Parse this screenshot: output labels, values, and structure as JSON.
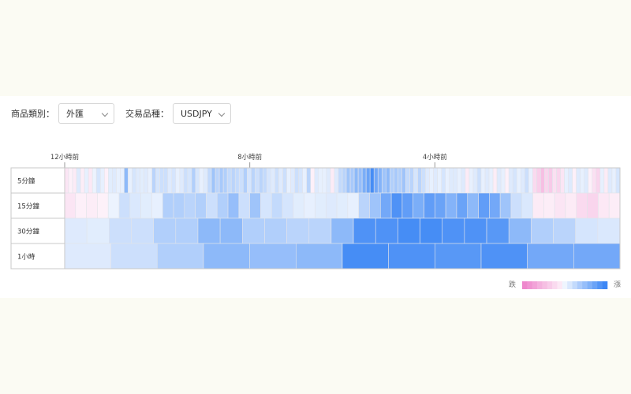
{
  "filters": {
    "category_label": "商品類別：",
    "category_value": "外匯",
    "symbol_label": "交易品種：",
    "symbol_value": "USDJPY"
  },
  "colors": {
    "up": "#3d87f5",
    "down": "#ee88cc",
    "border": "#c9c9c9"
  },
  "chart_data": {
    "type": "heatmap",
    "time_axis_labels": [
      {
        "text": "12小時前",
        "hours_ago": 12
      },
      {
        "text": "8小時前",
        "hours_ago": 8
      },
      {
        "text": "4小時前",
        "hours_ago": 4
      }
    ],
    "range_hours": 12,
    "value_range": [
      -1,
      1
    ],
    "rows": [
      {
        "label": "5分鐘",
        "values": [
          -0.15,
          -0.05,
          -0.1,
          0.1,
          -0.08,
          0.05,
          -0.12,
          0.02,
          0.15,
          0.05,
          -0.05,
          0.08,
          0.1,
          0.05,
          0.05,
          0.55,
          0.05,
          0.15,
          0.1,
          0.08,
          0.1,
          0.05,
          0.3,
          0.15,
          0.2,
          0.2,
          0.1,
          0.15,
          0.05,
          0.1,
          0.2,
          0.15,
          0.35,
          0.15,
          0.05,
          0.1,
          0.25,
          0.45,
          0.3,
          0.4,
          0.35,
          0.25,
          0.3,
          0.25,
          0.2,
          0.35,
          0.15,
          0.3,
          0.2,
          0.3,
          0.25,
          0.15,
          0.1,
          0.2,
          0.1,
          0.2,
          0.05,
          0.1,
          0.2,
          0.15,
          0.05,
          0.3,
          -0.05,
          0.1,
          0.05,
          0.05,
          0.1,
          -0.1,
          0.1,
          0.25,
          0.3,
          0.45,
          0.4,
          0.55,
          0.5,
          0.65,
          0.75,
          0.95,
          0.7,
          0.6,
          0.45,
          0.55,
          0.35,
          0.4,
          0.35,
          0.45,
          0.25,
          0.3,
          0.15,
          0.3,
          0.2,
          0.1,
          0.05,
          0.1,
          0.05,
          0.15,
          0.05,
          0.1,
          0.1,
          0.05,
          0.1,
          -0.1,
          0.05,
          0.1,
          0.2,
          0.05,
          0.1,
          0.05,
          -0.08,
          0.1,
          0.05,
          -0.05,
          0.1,
          0.15,
          0.05,
          0.1,
          0.2,
          0.05,
          -0.25,
          -0.35,
          -0.5,
          -0.3,
          -0.4,
          -0.2,
          -0.3,
          -0.15,
          0.05,
          0.1,
          -0.05,
          0.1,
          0.05,
          0.1,
          -0.05,
          -0.2,
          -0.3,
          0.05,
          -0.1,
          0.1,
          0.05,
          0.15
        ]
      },
      {
        "label": "15分鐘",
        "values": [
          -0.15,
          -0.05,
          -0.08,
          -0.04,
          0.02,
          0.2,
          0.12,
          0.08,
          0.05,
          0.35,
          0.35,
          0.3,
          0.35,
          0.2,
          0.35,
          0.5,
          0.2,
          0.45,
          0.15,
          0.25,
          0.15,
          0.08,
          0.05,
          0.08,
          0.1,
          0.08,
          0.05,
          0.3,
          0.45,
          0.7,
          0.9,
          0.8,
          0.65,
          0.8,
          0.75,
          0.6,
          0.75,
          0.55,
          0.8,
          0.7,
          0.45,
          0.2,
          0.12,
          -0.1,
          -0.08,
          -0.15,
          -0.1,
          -0.25,
          -0.3,
          -0.12,
          -0.08
        ]
      },
      {
        "label": "30分鐘",
        "values": [
          0.1,
          0.08,
          0.2,
          0.2,
          0.35,
          0.35,
          0.55,
          0.55,
          0.35,
          0.35,
          0.3,
          0.3,
          0.55,
          0.9,
          0.9,
          0.95,
          0.95,
          0.9,
          0.9,
          0.85,
          0.55,
          0.35,
          0.3,
          0.15,
          0.12
        ]
      },
      {
        "label": "1小時",
        "values": [
          0.1,
          0.2,
          0.35,
          0.55,
          0.5,
          0.55,
          0.95,
          0.9,
          0.85,
          0.9,
          0.7,
          0.7
        ]
      }
    ],
    "legend": {
      "left_label": "跌",
      "right_label": "漲",
      "steps": [
        -1,
        -0.88,
        -0.75,
        -0.62,
        -0.5,
        -0.38,
        -0.25,
        -0.12,
        0,
        0.12,
        0.25,
        0.38,
        0.5,
        0.62,
        0.75,
        0.88,
        1
      ]
    }
  }
}
